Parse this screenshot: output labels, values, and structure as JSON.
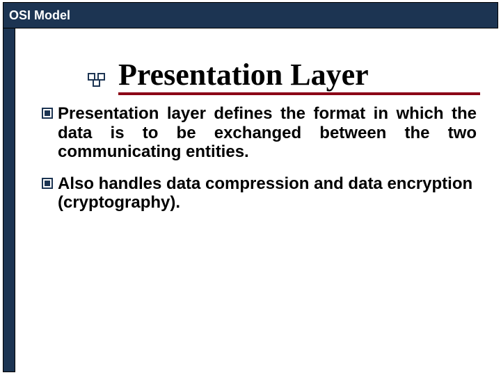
{
  "header": {
    "title": "OSI Model"
  },
  "slide": {
    "title": "Presentation Layer",
    "bullets": [
      "Presentation layer defines the format in which the data is to be exchanged between the two communicating entities.",
      "Also handles data compression and data encryption (cryptography)."
    ]
  },
  "colors": {
    "header_bg": "#1c3452",
    "accent_underline": "#8b0016"
  }
}
